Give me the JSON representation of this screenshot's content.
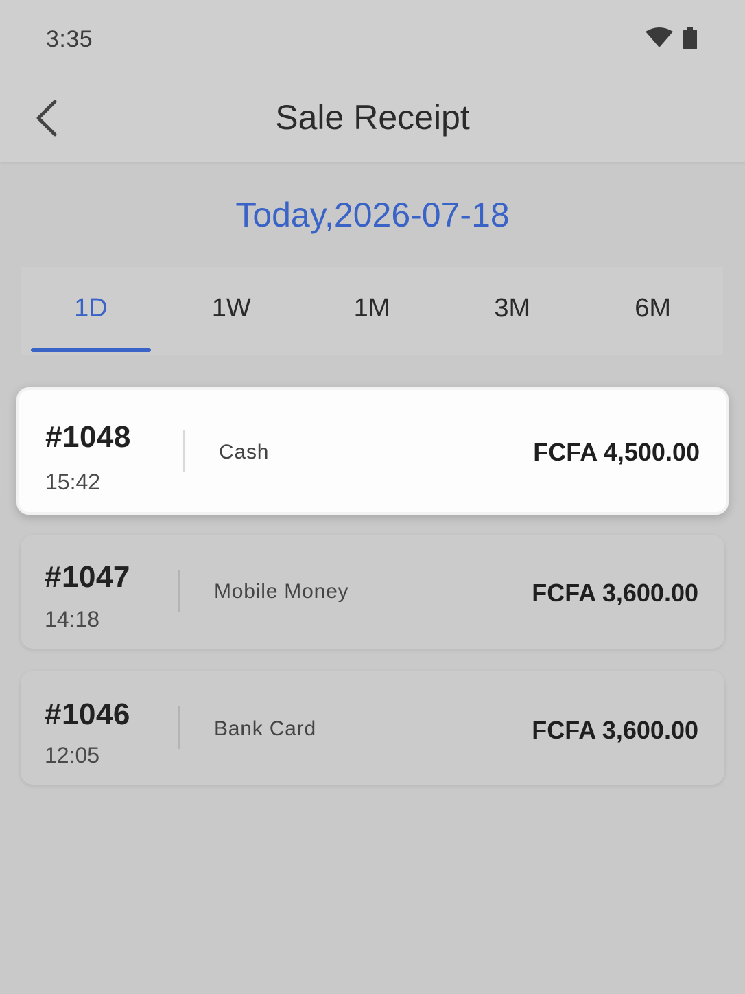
{
  "status_bar": {
    "time": "3:35",
    "icons": [
      "wifi-icon",
      "battery-icon"
    ]
  },
  "app_bar": {
    "title": "Sale Receipt",
    "back_icon": "chevron-left-icon"
  },
  "date_heading": "Today,2026-07-18",
  "tabs": [
    {
      "label": "1D",
      "active": true
    },
    {
      "label": "1W",
      "active": false
    },
    {
      "label": "1M",
      "active": false
    },
    {
      "label": "3M",
      "active": false
    },
    {
      "label": "6M",
      "active": false
    }
  ],
  "receipts": [
    {
      "number": "#1048",
      "time": "15:42",
      "method": "Cash",
      "amount": "FCFA 4,500.00",
      "selected": true
    },
    {
      "number": "#1047",
      "time": "14:18",
      "method": "Mobile Money",
      "amount": "FCFA 3,600.00",
      "selected": false
    },
    {
      "number": "#1046",
      "time": "12:05",
      "method": "Bank Card",
      "amount": "FCFA 3,600.00",
      "selected": false
    }
  ],
  "colors": {
    "accent": "#3a63c7",
    "background": "#c9c9c9",
    "selected_card": "#fdfdfd"
  }
}
